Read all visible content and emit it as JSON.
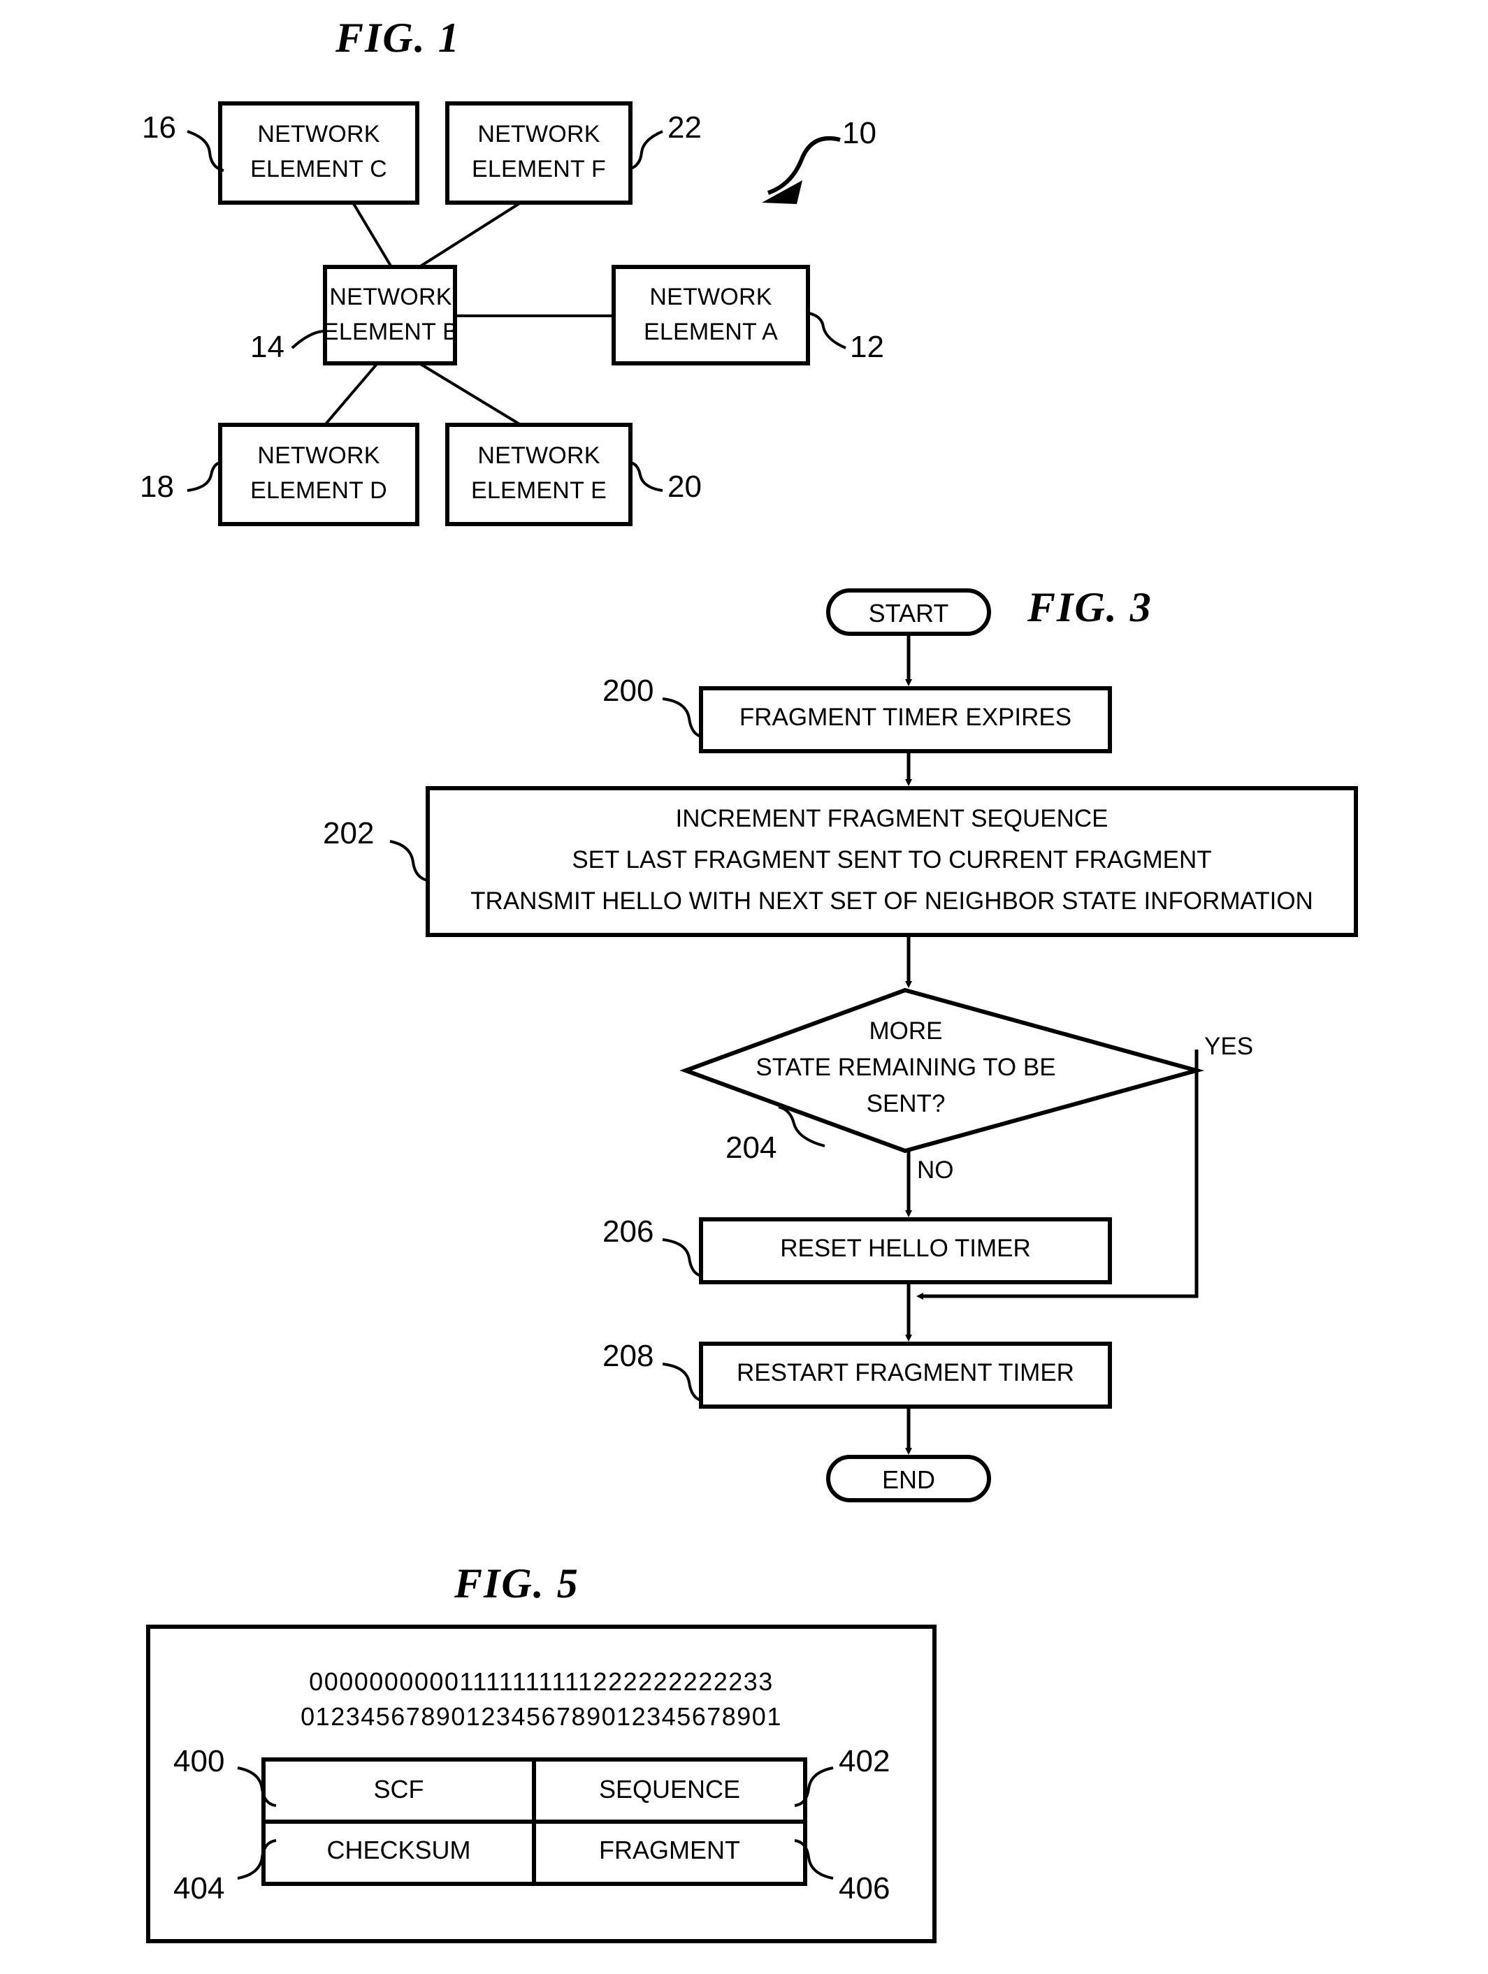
{
  "figures": [
    {
      "id": "fig1",
      "title": "FIG. 1",
      "system_ref": "10",
      "nodes": [
        {
          "ref": "16",
          "line1": "NETWORK",
          "line2": "ELEMENT C"
        },
        {
          "ref": "22",
          "line1": "NETWORK",
          "line2": "ELEMENT F"
        },
        {
          "ref": "14",
          "line1": "NETWORK",
          "line2": "ELEMENT B"
        },
        {
          "ref": "12",
          "line1": "NETWORK",
          "line2": "ELEMENT A"
        },
        {
          "ref": "18",
          "line1": "NETWORK",
          "line2": "ELEMENT D"
        },
        {
          "ref": "20",
          "line1": "NETWORK",
          "line2": "ELEMENT E"
        }
      ]
    },
    {
      "id": "fig3",
      "title": "FIG. 3",
      "start_label": "START",
      "end_label": "END",
      "yes_label": "YES",
      "no_label": "NO",
      "steps": [
        {
          "ref": "200",
          "kind": "process",
          "lines": [
            "FRAGMENT TIMER EXPIRES"
          ]
        },
        {
          "ref": "202",
          "kind": "process",
          "lines": [
            "INCREMENT FRAGMENT SEQUENCE",
            "SET LAST FRAGMENT SENT TO CURRENT FRAGMENT",
            "TRANSMIT HELLO WITH NEXT SET OF NEIGHBOR STATE INFORMATION"
          ]
        },
        {
          "ref": "204",
          "kind": "decision",
          "lines": [
            "MORE",
            "STATE REMAINING TO BE",
            "SENT?"
          ]
        },
        {
          "ref": "206",
          "kind": "process",
          "lines": [
            "RESET HELLO TIMER"
          ]
        },
        {
          "ref": "208",
          "kind": "process",
          "lines": [
            "RESTART FRAGMENT TIMER"
          ]
        }
      ]
    },
    {
      "id": "fig5",
      "title": "FIG. 5",
      "bit_ruler_top": "00000000001111111111222222222233",
      "bit_ruler_bottom": "01234567890123456789012345678901",
      "fields": [
        {
          "ref": "400",
          "name": "SCF"
        },
        {
          "ref": "402",
          "name": "SEQUENCE"
        },
        {
          "ref": "404",
          "name": "CHECKSUM"
        },
        {
          "ref": "406",
          "name": "FRAGMENT"
        }
      ]
    }
  ],
  "colors": {
    "ink": "#000000",
    "paper": "#ffffff"
  }
}
